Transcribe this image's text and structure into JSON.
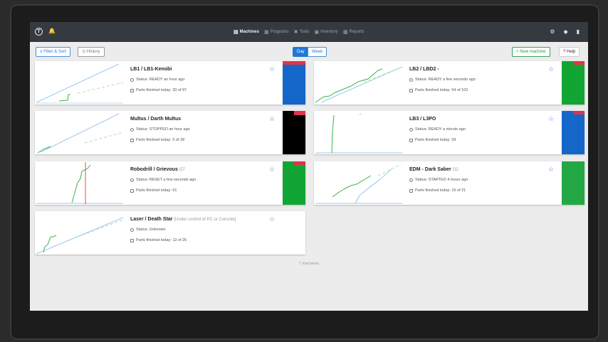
{
  "nav": {
    "links": [
      {
        "label": "Machines",
        "active": true,
        "icon": "machines-icon"
      },
      {
        "label": "Programs",
        "active": false,
        "icon": "document-icon"
      },
      {
        "label": "Tools",
        "active": false,
        "icon": "tools-icon"
      },
      {
        "label": "Inventory",
        "active": false,
        "icon": "inventory-icon"
      },
      {
        "label": "Reports",
        "active": false,
        "icon": "reports-icon"
      }
    ]
  },
  "toolbar": {
    "filter_label": "Filter & Sort",
    "history_label": "History",
    "day_label": "Day",
    "week_label": "Week",
    "new_machine_label": "+ New machine",
    "help_label": "? Help"
  },
  "machines": [
    {
      "name": "LB1 / LB1-Kenobi",
      "sub": "",
      "status": "Status: READY an hour ago",
      "parts": "Parts finished today: 20 of 97",
      "color": "#1466c8",
      "red": true
    },
    {
      "name": "LB2 / LBD2 -",
      "sub": "",
      "status": "Status: READY a few seconds ago",
      "parts": "Parts finished today: 54 of 102",
      "color": "#11a634",
      "red": true
    },
    {
      "name": "Multus / Darth Multus",
      "sub": "",
      "status": "Status: STOPPED an hour ago",
      "parts": "Parts finished today: 5 of 28",
      "color": "#000000",
      "red": true
    },
    {
      "name": "LB3 / L3PO",
      "sub": "",
      "status": "Status: READY a minute ago",
      "parts": "Parts finished today: 59",
      "color": "#1466c8",
      "red": true
    },
    {
      "name": "Robodrill / Grievous",
      "sub": "O7",
      "status": "Status: RESET a few seconds ago",
      "parts": "Parts finished today: 61",
      "color": "#11a634",
      "red": true
    },
    {
      "name": "EDM - Dark Saber",
      "sub": "O2",
      "status": "Status: STARTED 4 hours ago",
      "parts": "Parts finished today: 15 of 21",
      "color": "#23a845",
      "red": false
    },
    {
      "name": "Laser / Death Star",
      "sub": "[Under control of PC or Console]",
      "status": "Status: Unknown",
      "parts": "Parts finished today: 12 of 26",
      "color": "",
      "red": false
    }
  ],
  "footer": {
    "count": "7 machines"
  }
}
